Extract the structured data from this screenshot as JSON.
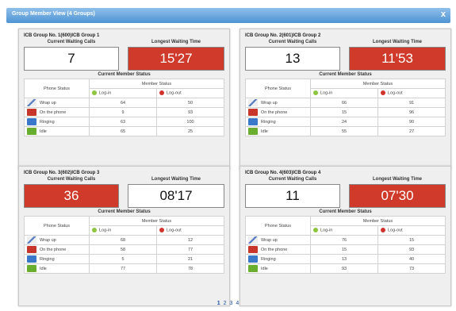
{
  "window": {
    "title": "Group Member View (4 Groups)",
    "close_label": "x"
  },
  "labels": {
    "current_waiting_calls": "Current Waiting Calls",
    "longest_waiting_time": "Longest Waiting Time",
    "current_member_status": "Current Member Status",
    "phone_status": "Phone Status",
    "member_status": "Member Status",
    "log_in": "Log-in",
    "log_out": "Log-out"
  },
  "status_rows": [
    "Wrap up",
    "On the phone",
    "Ringing",
    "Idle"
  ],
  "groups": [
    {
      "title": "ICB Group No. 1(600)ICB Group 1",
      "waiting_calls": "7",
      "waiting_time": "15'27",
      "calls_color": "#ffffff",
      "time_color": "#cf3a2a",
      "rows": [
        {
          "login": "64",
          "logout": "50"
        },
        {
          "login": "9",
          "logout": "93"
        },
        {
          "login": "63",
          "logout": "100"
        },
        {
          "login": "65",
          "logout": "25"
        }
      ]
    },
    {
      "title": "ICB Group No. 2(601)ICB Group 2",
      "waiting_calls": "13",
      "waiting_time": "11'53",
      "calls_color": "#ffffff",
      "time_color": "#cf3a2a",
      "rows": [
        {
          "login": "66",
          "logout": "91"
        },
        {
          "login": "15",
          "logout": "96"
        },
        {
          "login": "24",
          "logout": "90"
        },
        {
          "login": "55",
          "logout": "27"
        }
      ]
    },
    {
      "title": "ICB Group No. 3(602)ICB Group 3",
      "waiting_calls": "36",
      "waiting_time": "08'17",
      "calls_color": "#cf3a2a",
      "time_color": "#ffffff",
      "rows": [
        {
          "login": "68",
          "logout": "12"
        },
        {
          "login": "58",
          "logout": "77"
        },
        {
          "login": "5",
          "logout": "21"
        },
        {
          "login": "77",
          "logout": "78"
        }
      ]
    },
    {
      "title": "ICB Group No. 4(603)ICB Group 4",
      "waiting_calls": "11",
      "waiting_time": "07'30",
      "calls_color": "#ffffff",
      "time_color": "#cf3a2a",
      "rows": [
        {
          "login": "76",
          "logout": "15"
        },
        {
          "login": "15",
          "logout": "93"
        },
        {
          "login": "13",
          "logout": "40"
        },
        {
          "login": "93",
          "logout": "73"
        }
      ]
    }
  ],
  "pager": {
    "pages": [
      "1",
      "2",
      "3",
      "4"
    ],
    "current": "1"
  }
}
